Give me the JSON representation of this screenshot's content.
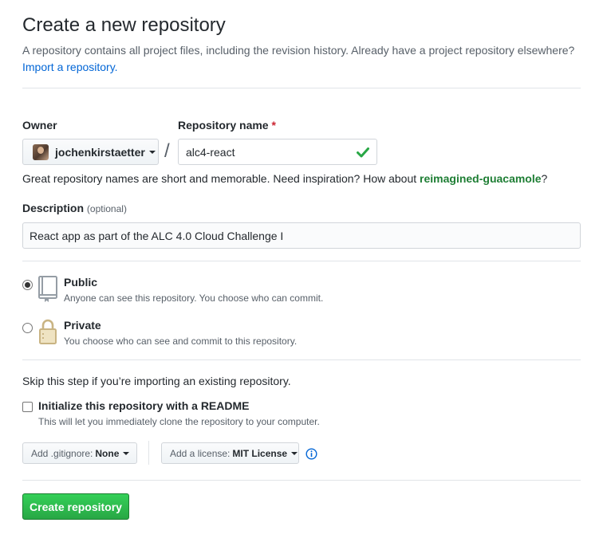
{
  "header": {
    "title": "Create a new repository",
    "subtitle": "A repository contains all project files, including the revision history. Already have a project repository elsewhere?",
    "import_link": "Import a repository."
  },
  "owner": {
    "label": "Owner",
    "value": "jochenkirstaetter",
    "avatar_icon": "user-avatar"
  },
  "separator": "/",
  "repo_name": {
    "label": "Repository name",
    "required_marker": "*",
    "value": "alc4-react",
    "valid_icon": "check-icon"
  },
  "inspiration": {
    "prefix": "Great repository names are short and memorable. Need inspiration? How about",
    "suggestion": "reimagined-guacamole",
    "suffix": "?"
  },
  "description": {
    "label": "Description",
    "optional": "(optional)",
    "value": "React app as part of the ALC 4.0 Cloud Challenge I"
  },
  "visibility": {
    "selected": "public",
    "options": [
      {
        "key": "public",
        "title": "Public",
        "note": "Anyone can see this repository. You choose who can commit.",
        "icon": "repo-book-icon"
      },
      {
        "key": "private",
        "title": "Private",
        "note": "You choose who can see and commit to this repository.",
        "icon": "lock-icon"
      }
    ]
  },
  "init": {
    "skip_text": "Skip this step if you’re importing an existing repository.",
    "readme_label": "Initialize this repository with a README",
    "readme_note": "This will let you immediately clone the repository to your computer.",
    "readme_checked": false
  },
  "gitignore": {
    "prefix": "Add .gitignore:",
    "value": "None"
  },
  "license": {
    "prefix": "Add a license:",
    "value": "MIT License",
    "info_icon": "info-icon"
  },
  "submit": {
    "label": "Create repository"
  },
  "colors": {
    "accent_link": "#0366d6",
    "primary_button": "#28a745",
    "valid_check": "#28a745",
    "required": "#cb2431"
  }
}
